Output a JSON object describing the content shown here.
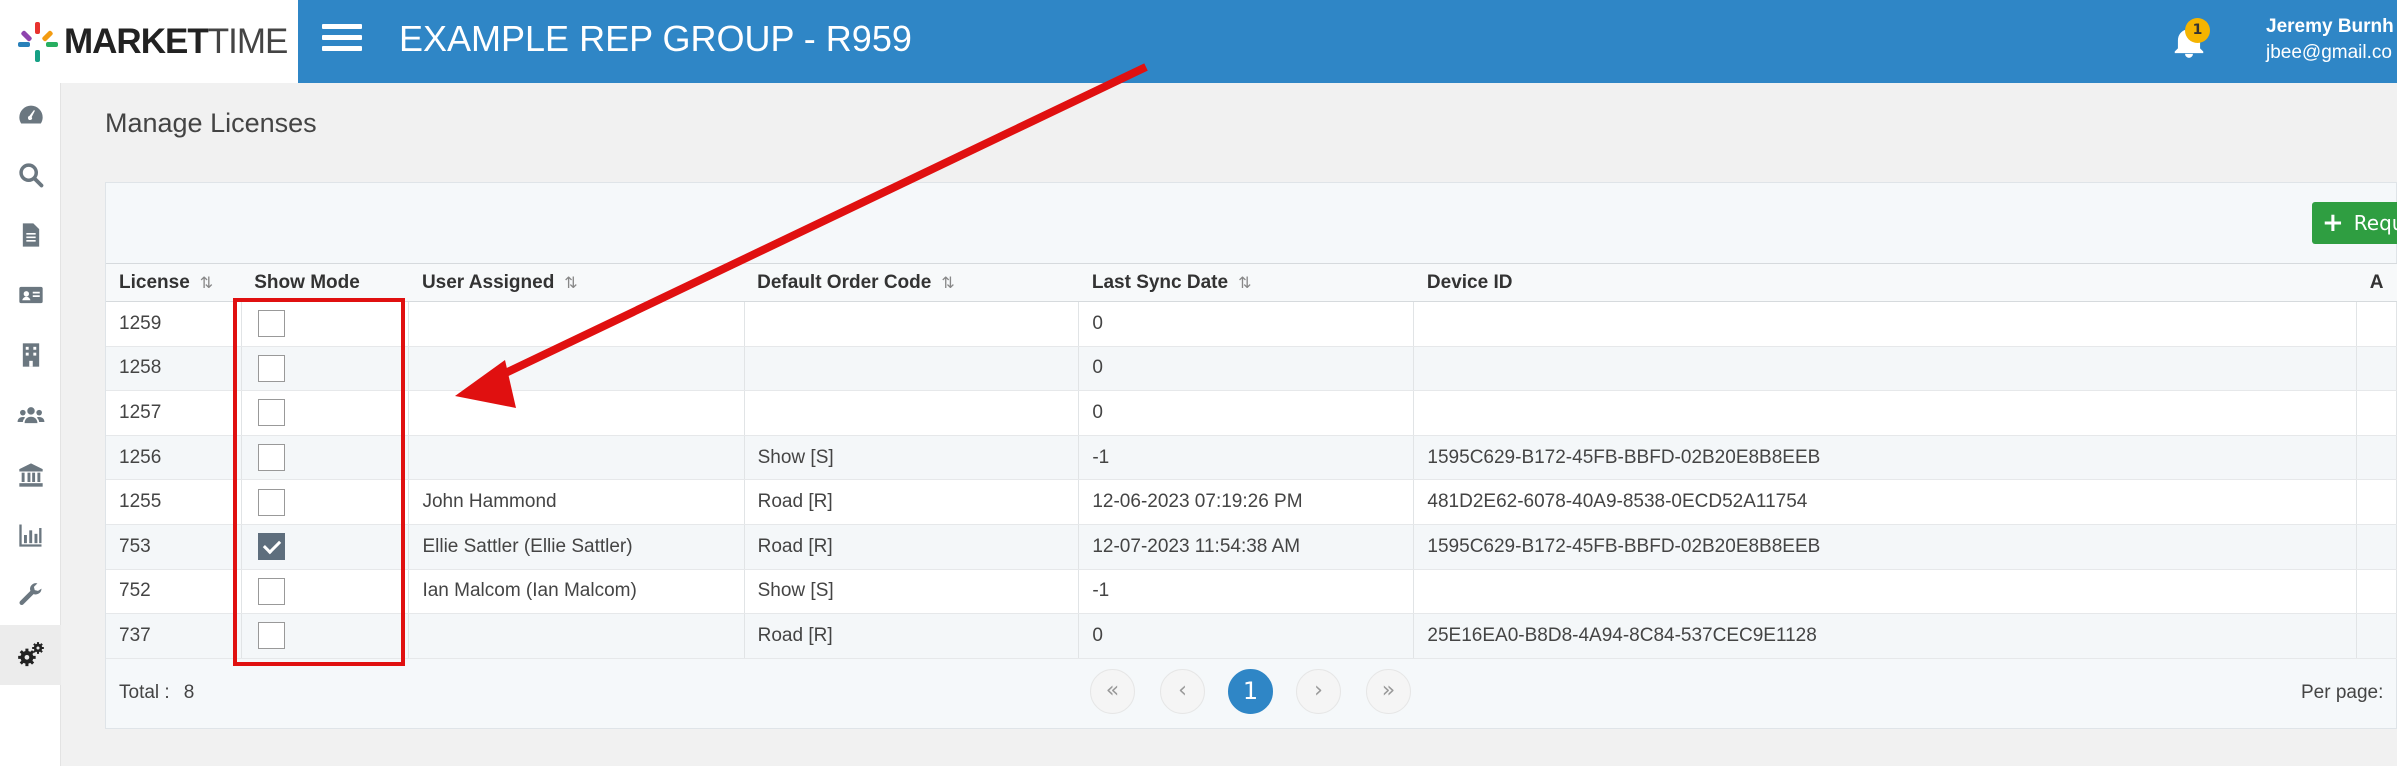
{
  "header": {
    "logo_text_bold": "MARKET",
    "logo_text_light": "TIME",
    "app_title": "EXAMPLE REP GROUP - R959",
    "notification_count": "1",
    "user_name": "Jeremy Burnh",
    "user_email": "jbee@gmail.co"
  },
  "colors": {
    "topbar": "#2f86c6",
    "request_button": "#2f9e41",
    "annotation": "#e01010"
  },
  "sidebar": {
    "items": [
      {
        "icon": "dashboard-icon"
      },
      {
        "icon": "search-icon"
      },
      {
        "icon": "document-icon"
      },
      {
        "icon": "contact-card-icon"
      },
      {
        "icon": "building-icon"
      },
      {
        "icon": "users-icon"
      },
      {
        "icon": "bank-icon"
      },
      {
        "icon": "bar-chart-icon"
      },
      {
        "icon": "wrench-icon"
      },
      {
        "icon": "gears-icon",
        "active": true
      }
    ]
  },
  "page": {
    "title": "Manage Licenses",
    "request_button_label": "Reque"
  },
  "table": {
    "columns": [
      "License",
      "Show Mode",
      "User Assigned",
      "Default Order Code",
      "Last Sync Date",
      "Device ID",
      "A"
    ],
    "rows": [
      {
        "license": "1259",
        "show_mode": false,
        "user": "",
        "order_code": "",
        "last_sync": "0",
        "device_id": ""
      },
      {
        "license": "1258",
        "show_mode": false,
        "user": "",
        "order_code": "",
        "last_sync": "0",
        "device_id": ""
      },
      {
        "license": "1257",
        "show_mode": false,
        "user": "",
        "order_code": "",
        "last_sync": "0",
        "device_id": ""
      },
      {
        "license": "1256",
        "show_mode": false,
        "user": "",
        "order_code": "Show [S]",
        "last_sync": "-1",
        "device_id": "1595C629-B172-45FB-BBFD-02B20E8B8EEB"
      },
      {
        "license": "1255",
        "show_mode": false,
        "user": "John Hammond",
        "order_code": "Road [R]",
        "last_sync": "12-06-2023 07:19:26 PM",
        "device_id": "481D2E62-6078-40A9-8538-0ECD52A11754"
      },
      {
        "license": "753",
        "show_mode": true,
        "user": "Ellie Sattler (Ellie Sattler)",
        "order_code": "Road [R]",
        "last_sync": "12-07-2023 11:54:38 AM",
        "device_id": "1595C629-B172-45FB-BBFD-02B20E8B8EEB"
      },
      {
        "license": "752",
        "show_mode": false,
        "user": "Ian Malcom (Ian Malcom)",
        "order_code": "Show [S]",
        "last_sync": "-1",
        "device_id": ""
      },
      {
        "license": "737",
        "show_mode": false,
        "user": "",
        "order_code": "Road [R]",
        "last_sync": "0",
        "device_id": "25E16EA0-B8D8-4A94-8C84-537CEC9E1128"
      }
    ]
  },
  "footer": {
    "total_label": "Total :",
    "total_value": "8",
    "pagination": {
      "first": "«",
      "prev": "‹",
      "current": "1",
      "next": "›",
      "last": "»"
    },
    "per_page_label": "Per page:"
  }
}
